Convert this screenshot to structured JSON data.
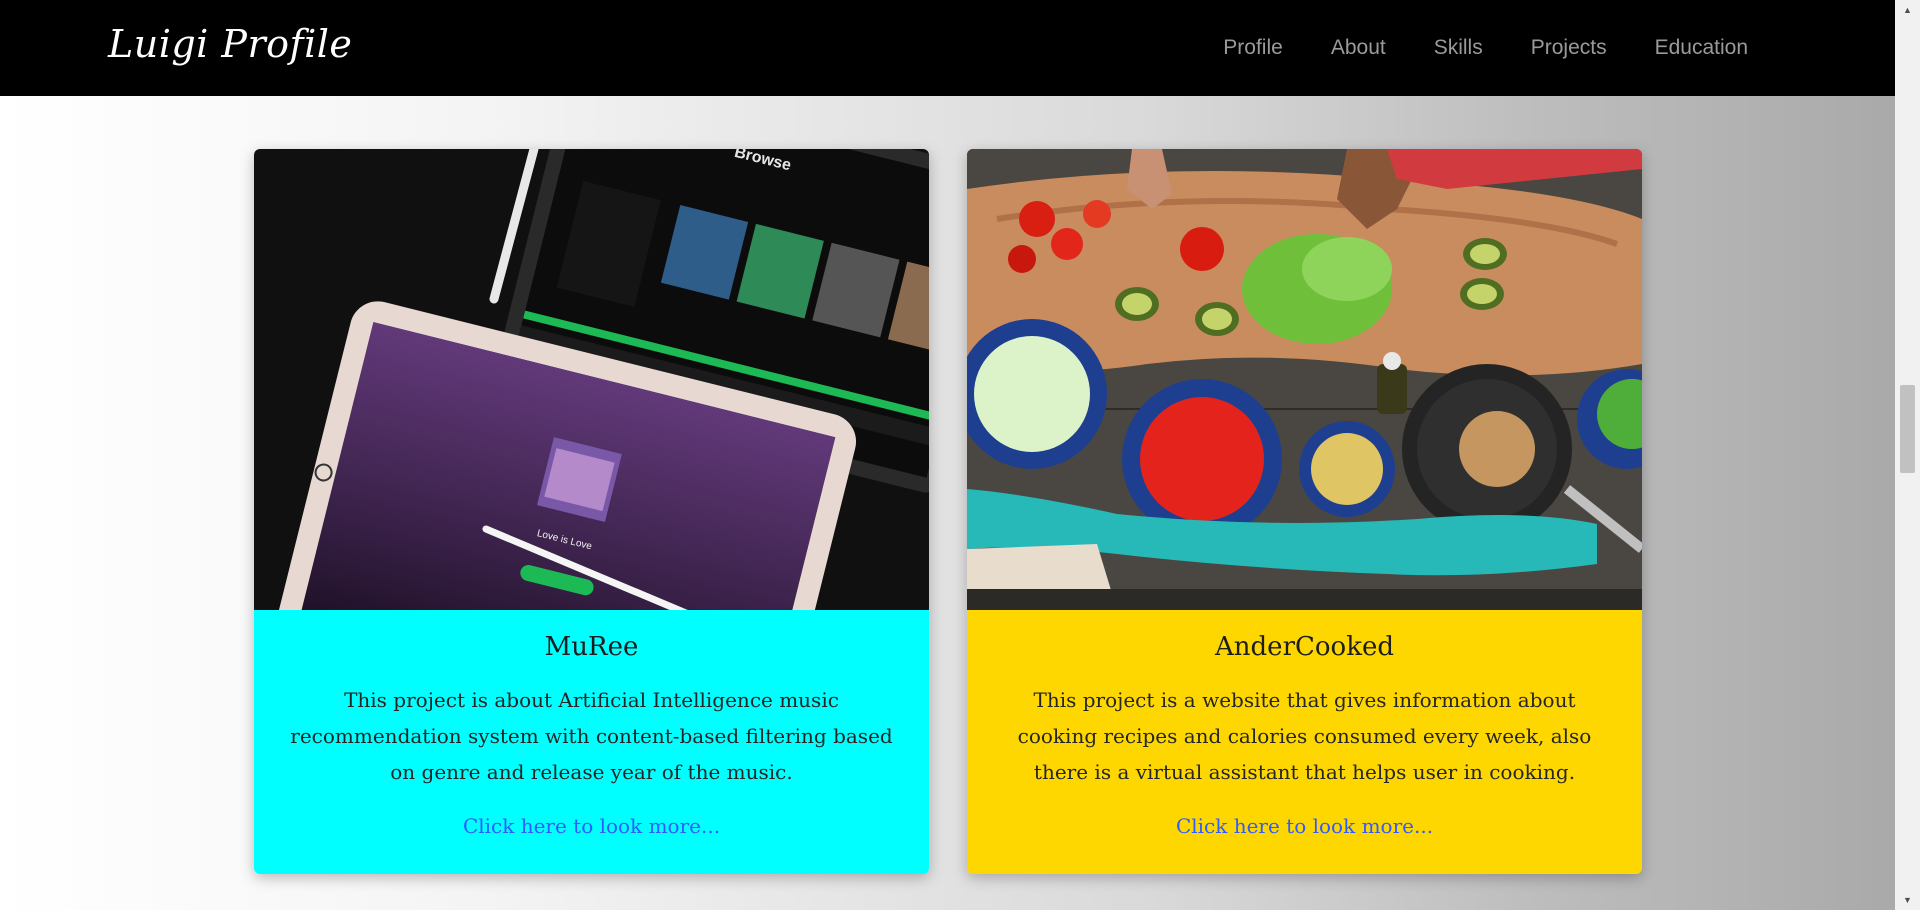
{
  "navbar": {
    "brand": "Luigi Profile",
    "links": [
      "Profile",
      "About",
      "Skills",
      "Projects",
      "Education"
    ]
  },
  "projects": [
    {
      "title": "MuRee",
      "description": "This project is about Artificial Intelligence music recommendation system with content-based filtering based on genre and release year of the music.",
      "link_label": "Click here to look more...",
      "accent": "#00ffff"
    },
    {
      "title": "AnderCooked",
      "description": "This project is a website that gives information about cooking recipes and calories consumed every week, also there is a virtual assistant that helps user in cooking.",
      "link_label": "Click here to look more...",
      "accent": "#ffd700"
    }
  ],
  "colors": {
    "navbar_bg": "#000000",
    "nav_link": "#9a9a9a",
    "link": "#2f5bff"
  }
}
